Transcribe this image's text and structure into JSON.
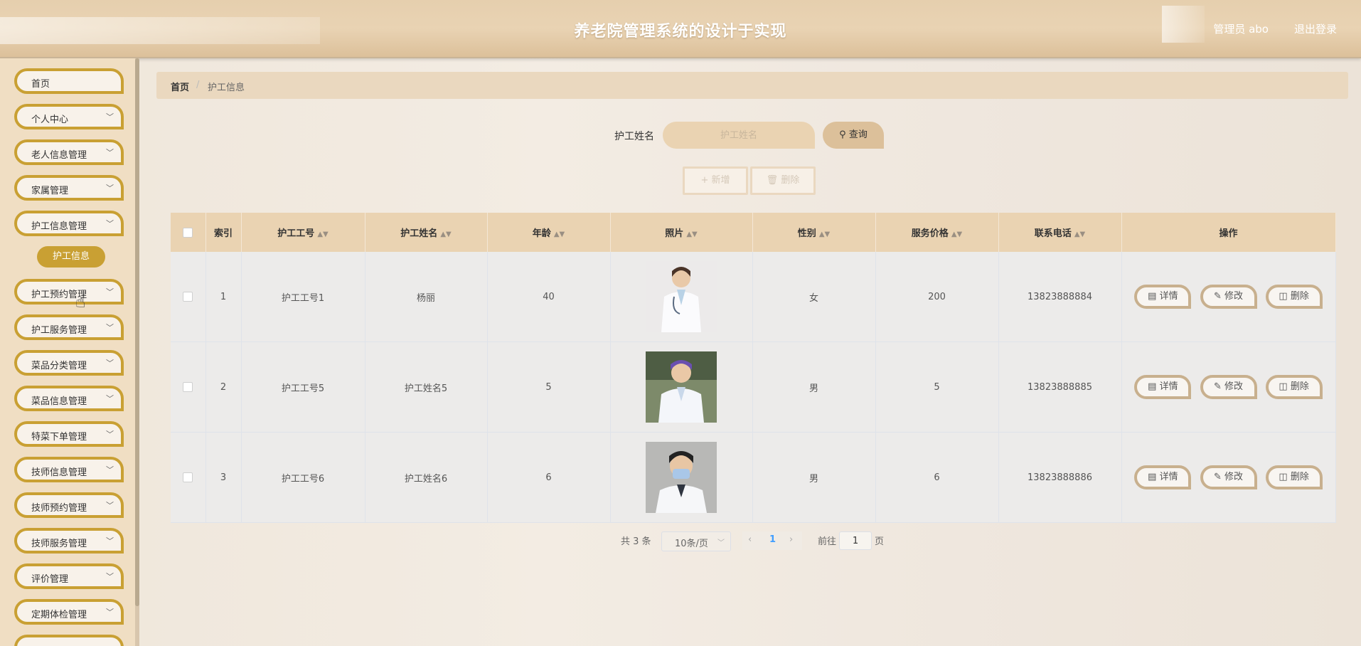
{
  "header": {
    "title": "养老院管理系统的设计于实现",
    "user": "管理员 abo",
    "logout": "退出登录"
  },
  "sidebar": {
    "items": [
      {
        "label": "首页",
        "expandable": false
      },
      {
        "label": "个人中心",
        "expandable": true
      },
      {
        "label": "老人信息管理",
        "expandable": true
      },
      {
        "label": "家属管理",
        "expandable": true
      },
      {
        "label": "护工信息管理",
        "expandable": true
      },
      {
        "label": "护工预约管理",
        "expandable": true
      },
      {
        "label": "护工服务管理",
        "expandable": true
      },
      {
        "label": "菜品分类管理",
        "expandable": true
      },
      {
        "label": "菜品信息管理",
        "expandable": true
      },
      {
        "label": "特菜下单管理",
        "expandable": true
      },
      {
        "label": "技师信息管理",
        "expandable": true
      },
      {
        "label": "技师预约管理",
        "expandable": true
      },
      {
        "label": "技师服务管理",
        "expandable": true
      },
      {
        "label": "评价管理",
        "expandable": true
      },
      {
        "label": "定期体检管理",
        "expandable": true
      }
    ],
    "active_sub": "护工信息",
    "chevron_icon": "chevron-down-icon",
    "accent_color": "#c9a033"
  },
  "breadcrumb": {
    "home": "首页",
    "sep": "/",
    "current": "护工信息"
  },
  "search": {
    "label": "护工姓名",
    "placeholder": "护工姓名",
    "value": "",
    "button": "查询"
  },
  "toolbar": {
    "add": "新增",
    "delete": "删除"
  },
  "table": {
    "columns": [
      "索引",
      "护工工号",
      "护工姓名",
      "年龄",
      "照片",
      "性别",
      "服务价格",
      "联系电话",
      "操作"
    ],
    "rows": [
      {
        "index": "1",
        "id": "护工工号1",
        "name": "杨丽",
        "age": "40",
        "photo": "doctor-photo-icon",
        "gender": "女",
        "price": "200",
        "phone": "13823888884"
      },
      {
        "index": "2",
        "id": "护工工号5",
        "name": "护工姓名5",
        "age": "5",
        "photo": "doctor-photo-icon",
        "gender": "男",
        "price": "5",
        "phone": "13823888885"
      },
      {
        "index": "3",
        "id": "护工工号6",
        "name": "护工姓名6",
        "age": "6",
        "photo": "doctor-photo-icon",
        "gender": "男",
        "price": "6",
        "phone": "13823888886"
      }
    ],
    "actions": {
      "detail": "详情",
      "edit": "修改",
      "delete": "删除"
    }
  },
  "pagination": {
    "total": "共 3 条",
    "page_size": "10条/页",
    "current_page": "1",
    "goto": "前往",
    "goto_value": "1",
    "unit": "页"
  }
}
